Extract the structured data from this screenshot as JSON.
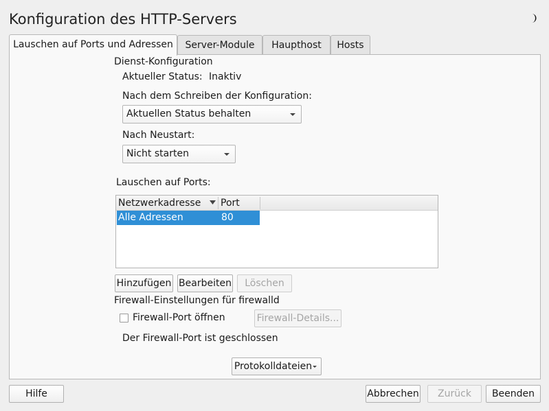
{
  "window": {
    "title": "Konfiguration des HTTP-Servers"
  },
  "tabs": [
    {
      "label": "Lauschen auf Ports und Adressen",
      "active": true
    },
    {
      "label": "Server-Module",
      "active": false
    },
    {
      "label": "Haupthost",
      "active": false
    },
    {
      "label": "Hosts",
      "active": false
    }
  ],
  "service": {
    "section_label": "Dienst-Konfiguration",
    "status_label": "Aktueller Status:",
    "status_value": "Inaktiv",
    "after_write_label": "Nach dem Schreiben der Konfiguration:",
    "after_write_value": "Aktuellen Status behalten",
    "after_reboot_label": "Nach Neustart:",
    "after_reboot_value": "Nicht starten"
  },
  "ports": {
    "section_label": "Lauschen auf Ports:",
    "columns": [
      "Netzwerkadresse",
      "Port"
    ],
    "rows": [
      {
        "address": "Alle Adressen",
        "port": "80",
        "selected": true
      }
    ],
    "add_label": "Hinzufügen",
    "edit_label": "Bearbeiten",
    "delete_label": "Löschen"
  },
  "firewall": {
    "section_label": "Firewall-Einstellungen für firewalld",
    "open_port_label": "Firewall-Port öffnen",
    "open_port_checked": false,
    "details_label": "Firewall-Details...",
    "status_text": "Der Firewall-Port ist geschlossen"
  },
  "log_files_label": "Protokolldateien",
  "footer": {
    "help_label": "Hilfe",
    "cancel_label": "Abbrechen",
    "back_label": "Zurück",
    "finish_label": "Beenden"
  },
  "colors": {
    "selection": "#2f8fd6",
    "background": "#efefef",
    "panel": "#f9f9f9"
  }
}
